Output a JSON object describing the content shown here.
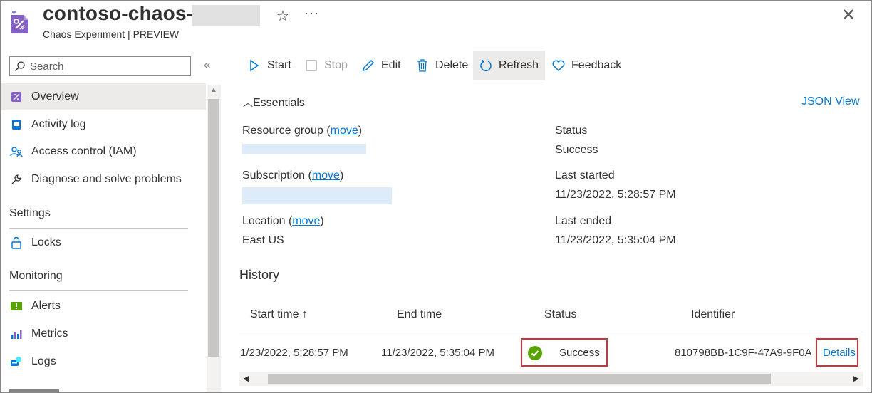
{
  "header": {
    "title": "contoso-chaos-",
    "subtitle": "Chaos Experiment | PREVIEW",
    "more_label": "···",
    "close_label": "✕"
  },
  "sidebar": {
    "search_placeholder": "Search",
    "collapse_label": "«",
    "items": [
      {
        "label": "Overview"
      },
      {
        "label": "Activity log"
      },
      {
        "label": "Access control (IAM)"
      },
      {
        "label": "Diagnose and solve problems"
      }
    ],
    "sections": [
      {
        "title": "Settings",
        "items": [
          {
            "label": "Locks"
          }
        ]
      },
      {
        "title": "Monitoring",
        "items": [
          {
            "label": "Alerts"
          },
          {
            "label": "Metrics"
          },
          {
            "label": "Logs"
          }
        ]
      }
    ]
  },
  "toolbar": {
    "start": "Start",
    "stop": "Stop",
    "edit": "Edit",
    "delete": "Delete",
    "refresh": "Refresh",
    "feedback": "Feedback"
  },
  "essentials": {
    "toggle": "Essentials",
    "json_view": "JSON View",
    "resource_group_label": "Resource group",
    "subscription_label": "Subscription",
    "location_label": "Location",
    "move": "move",
    "location_value": "East US",
    "status_label": "Status",
    "status_value": "Success",
    "last_started_label": "Last started",
    "last_started_value": "11/23/2022, 5:28:57 PM",
    "last_ended_label": "Last ended",
    "last_ended_value": "11/23/2022, 5:35:04 PM"
  },
  "history": {
    "title": "History",
    "columns": [
      "Start time ↑",
      "End time",
      "Status",
      "Identifier"
    ],
    "rows": [
      {
        "start": "1/23/2022, 5:28:57 PM",
        "end": "11/23/2022, 5:35:04 PM",
        "status": "Success",
        "identifier": "810798BB-1C9F-47A9-9F0A",
        "details": "Details"
      }
    ]
  },
  "colors": {
    "accent": "#0078d4",
    "success": "#57a300",
    "highlight_border": "#d13438",
    "nav_active": "#edebe9"
  },
  "icons": {
    "resource": "chaos-experiment-icon",
    "star": "star-icon",
    "close": "close-icon",
    "search": "search-icon",
    "overview": "overview-icon",
    "activity_log": "activity-log-icon",
    "iam": "people-icon",
    "diagnose": "wrench-icon",
    "locks": "lock-icon",
    "alerts": "alert-icon",
    "metrics": "metrics-icon",
    "logs": "logs-icon",
    "start": "play-icon",
    "stop": "stop-icon",
    "edit": "pencil-icon",
    "delete": "trash-icon",
    "refresh": "refresh-icon",
    "feedback": "heart-icon",
    "success": "success-check-icon"
  }
}
